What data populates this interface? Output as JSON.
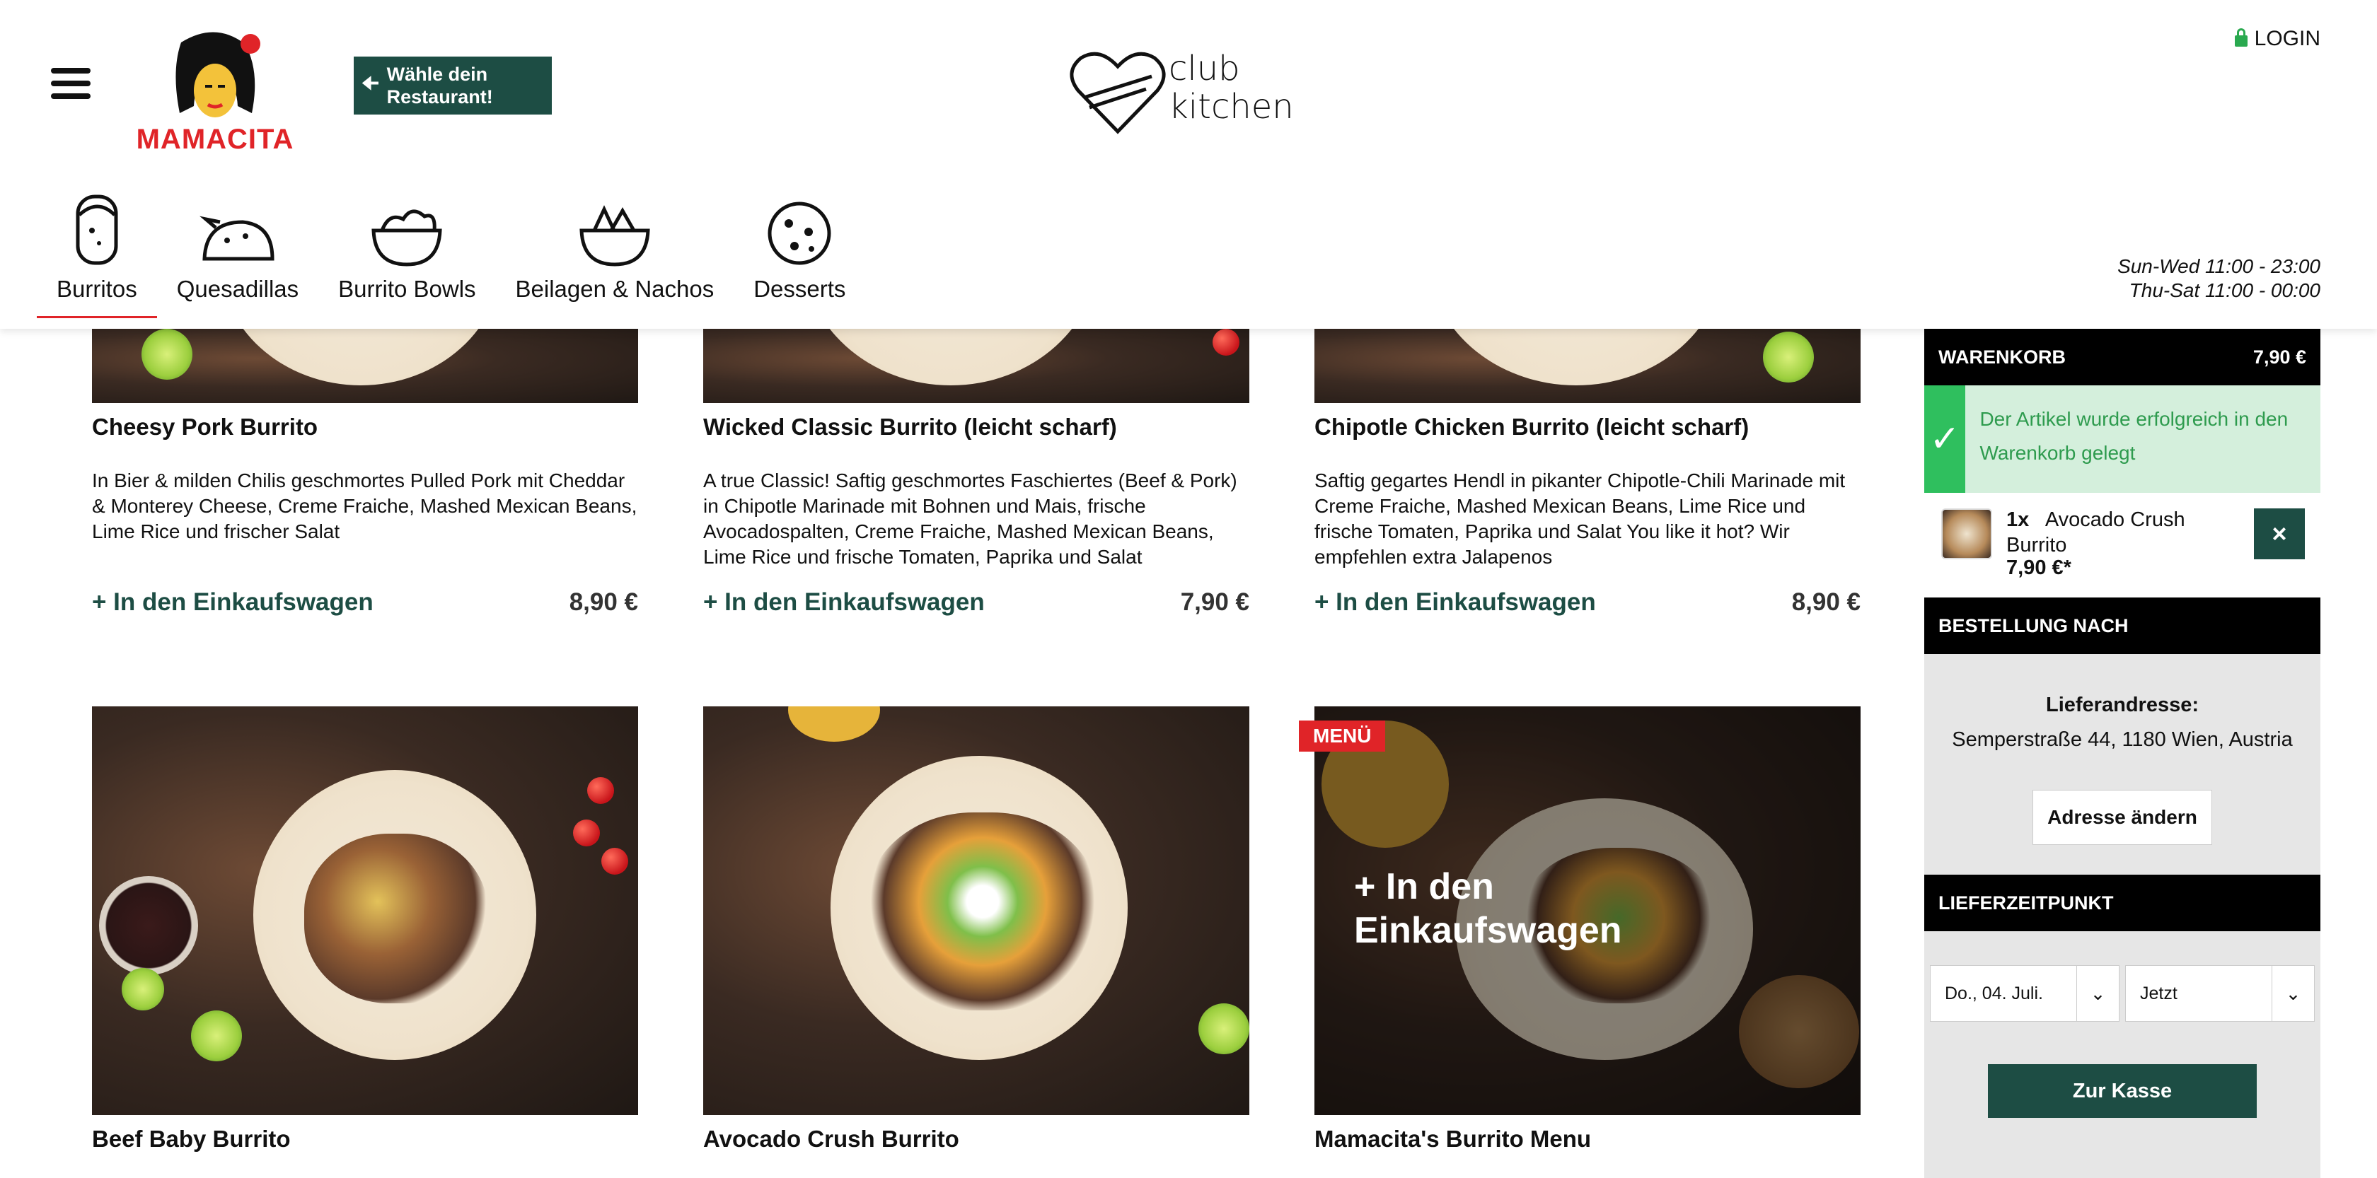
{
  "header": {
    "logo_text": "MAMACITA",
    "restaurant_button": "Wähle dein Restaurant!",
    "club_logo_line1": "club",
    "club_logo_line2": "kitchen",
    "login": "LOGIN",
    "hours_line1": "Sun-Wed 11:00 - 23:00",
    "hours_line2": "Thu-Sat 11:00 - 00:00"
  },
  "categories": [
    {
      "label": "Burritos",
      "icon": "burrito-icon",
      "active": true
    },
    {
      "label": "Quesadillas",
      "icon": "quesadilla-icon"
    },
    {
      "label": "Burrito Bowls",
      "icon": "bowl-icon"
    },
    {
      "label": "Beilagen & Nachos",
      "icon": "nachos-icon"
    },
    {
      "label": "Desserts",
      "icon": "cookie-icon"
    }
  ],
  "products": [
    {
      "title": "Cheesy Pork Burrito",
      "desc": "In Bier & milden Chilis geschmortes Pulled Pork mit Cheddar & Monterey Cheese, Creme Fraiche, Mashed Mexican Beans, Lime Rice und frischer Salat",
      "add": "+ In den Einkaufswagen",
      "price": "8,90 €"
    },
    {
      "title": "Wicked Classic Burrito (leicht scharf)",
      "desc": "A true Classic! Saftig geschmortes Faschiertes (Beef & Pork) in Chipotle Marinade mit Bohnen und Mais, frische Avocadospalten, Creme Fraiche, Mashed Mexican Beans, Lime Rice und frische Tomaten, Paprika und Salat",
      "add": "+ In den Einkaufswagen",
      "price": "7,90 €"
    },
    {
      "title": "Chipotle Chicken Burrito (leicht scharf)",
      "desc": "Saftig gegartes Hendl in pikanter Chipotle-Chili Marinade mit Creme Fraiche, Mashed Mexican Beans, Lime Rice und frische Tomaten, Paprika und Salat You like it hot? Wir empfehlen extra Jalapenos",
      "add": "+ In den Einkaufswagen",
      "price": "8,90 €"
    },
    {
      "title": "Beef Baby Burrito"
    },
    {
      "title": "Avocado Crush Burrito"
    },
    {
      "title": "Mamacita's Burrito Menu",
      "badge": "MENÜ",
      "overlay_add": "+ In den Einkaufswagen"
    }
  ],
  "cart": {
    "header": "WARENKORB",
    "total": "7,90 €",
    "success": "Der Artikel wurde erfolgreich in den Warenkorb gelegt",
    "item_qty": "1x",
    "item_name": "Avocado Crush Burrito",
    "item_price": "7,90 €*",
    "remove": "×",
    "order_header": "BESTELLUNG NACH",
    "address_label": "Lieferandresse:",
    "address": "Semperstraße 44, 1180 Wien, Austria",
    "change_address": "Adresse ändern",
    "time_header": "LIEFERZEITPUNKT",
    "date_value": "Do., 04. Juli.",
    "time_value": "Jetzt",
    "checkout": "Zur Kasse"
  },
  "colors": {
    "brand_green": "#1d4d44",
    "brand_red": "#e02428",
    "success_green": "#2fbf5e"
  }
}
